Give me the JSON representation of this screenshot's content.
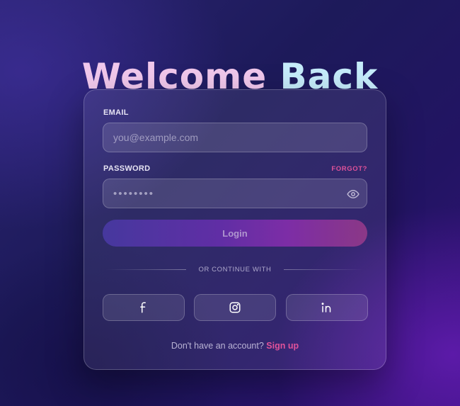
{
  "header": {
    "title_word_1": "Welcome",
    "title_word_2": "Back"
  },
  "form": {
    "email": {
      "label": "EMAIL",
      "value": "",
      "placeholder": "you@example.com"
    },
    "password": {
      "label": "PASSWORD",
      "value": "",
      "placeholder": "••••••••",
      "forgot_label": "FORGOT?",
      "toggle_icon": "eye-icon"
    },
    "login_label": "Login"
  },
  "divider": {
    "text": "OR CONTINUE WITH"
  },
  "social": [
    {
      "icon": "facebook-icon"
    },
    {
      "icon": "instagram-icon"
    },
    {
      "icon": "linkedin-icon"
    }
  ],
  "footer": {
    "prompt": "Don't have an account?",
    "signup_label": "Sign up"
  },
  "colors": {
    "accent_pink": "#e0529a",
    "title_pink": "#f1c8ec",
    "title_cyan": "#c6ecfb",
    "background_dark": "#1d1a5a"
  }
}
